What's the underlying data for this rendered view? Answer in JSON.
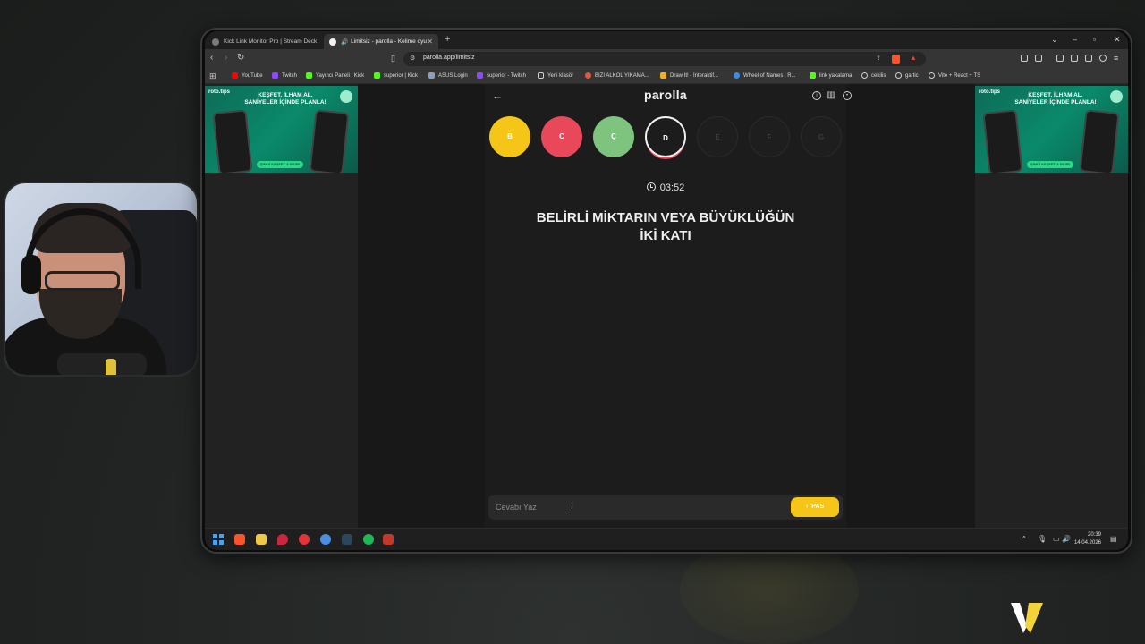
{
  "browser": {
    "tabs": [
      {
        "title": "Kick Link Monitor Pro | Stream Deck",
        "active": false
      },
      {
        "title": "Limitsiz - parolla - Kelime oyu",
        "active": true
      }
    ],
    "url": "parolla.app/limitsiz",
    "bookmarks": [
      {
        "label": "YouTube",
        "color": "#ff0000"
      },
      {
        "label": "Twitch",
        "color": "#9146ff"
      },
      {
        "label": "Yayıncı Paneli | Kick",
        "color": "#53fc18"
      },
      {
        "label": "superior | Kick",
        "color": "#53fc18"
      },
      {
        "label": "ASUS Login",
        "color": "#8aa0b8"
      },
      {
        "label": "superior - Twitch",
        "color": "#9146ff"
      },
      {
        "label": "Yeni klasör",
        "color": "#cfcfcf"
      },
      {
        "label": "BIZI ALKOL YIKAMA...",
        "color": "#e05a3a"
      },
      {
        "label": "Draw It! - İnteraktif...",
        "color": "#f0b020"
      },
      {
        "label": "Wheel of Names | R...",
        "color": "#3a8ee0"
      },
      {
        "label": "link yakalama",
        "color": "#53fc18"
      },
      {
        "label": "cekilis",
        "color": "#cfcfcf"
      },
      {
        "label": "gartic",
        "color": "#cfcfcf"
      },
      {
        "label": "Vite + React + TS",
        "color": "#cfcfcf"
      }
    ]
  },
  "ads": {
    "brand": "roto.tips",
    "headline_line1": "KEŞFET, İLHAM AL.",
    "headline_line2": "SANİYELER İÇİNDE PLANLA!",
    "cta": "ŞİMDİ KEŞFET & İNDİR"
  },
  "game": {
    "logo": "parolla",
    "letters": [
      {
        "letter": "B",
        "state": "correct-yellow",
        "color": "#f5c518"
      },
      {
        "letter": "C",
        "state": "wrong",
        "color": "#e8485a"
      },
      {
        "letter": "Ç",
        "state": "correct",
        "color": "#7ec47e"
      },
      {
        "letter": "D",
        "state": "active",
        "color": "#1c1c1c"
      },
      {
        "letter": "E",
        "state": "pending",
        "color": "#1e1e1e"
      },
      {
        "letter": "F",
        "state": "pending",
        "color": "#1e1e1e"
      },
      {
        "letter": "G",
        "state": "pending",
        "color": "#1e1e1e"
      }
    ],
    "timer": "03:52",
    "question_line1": "BELİRLİ MİKTARIN VEYA BÜYÜKLÜĞÜN",
    "question_line2": "İKİ KATI",
    "answer_placeholder": "Cevabı Yaz",
    "pass_label": "PAS",
    "pass_arrow": "›",
    "accent": "#f5c518"
  },
  "taskbar": {
    "time": "20:39",
    "date": "14.04.2026"
  }
}
